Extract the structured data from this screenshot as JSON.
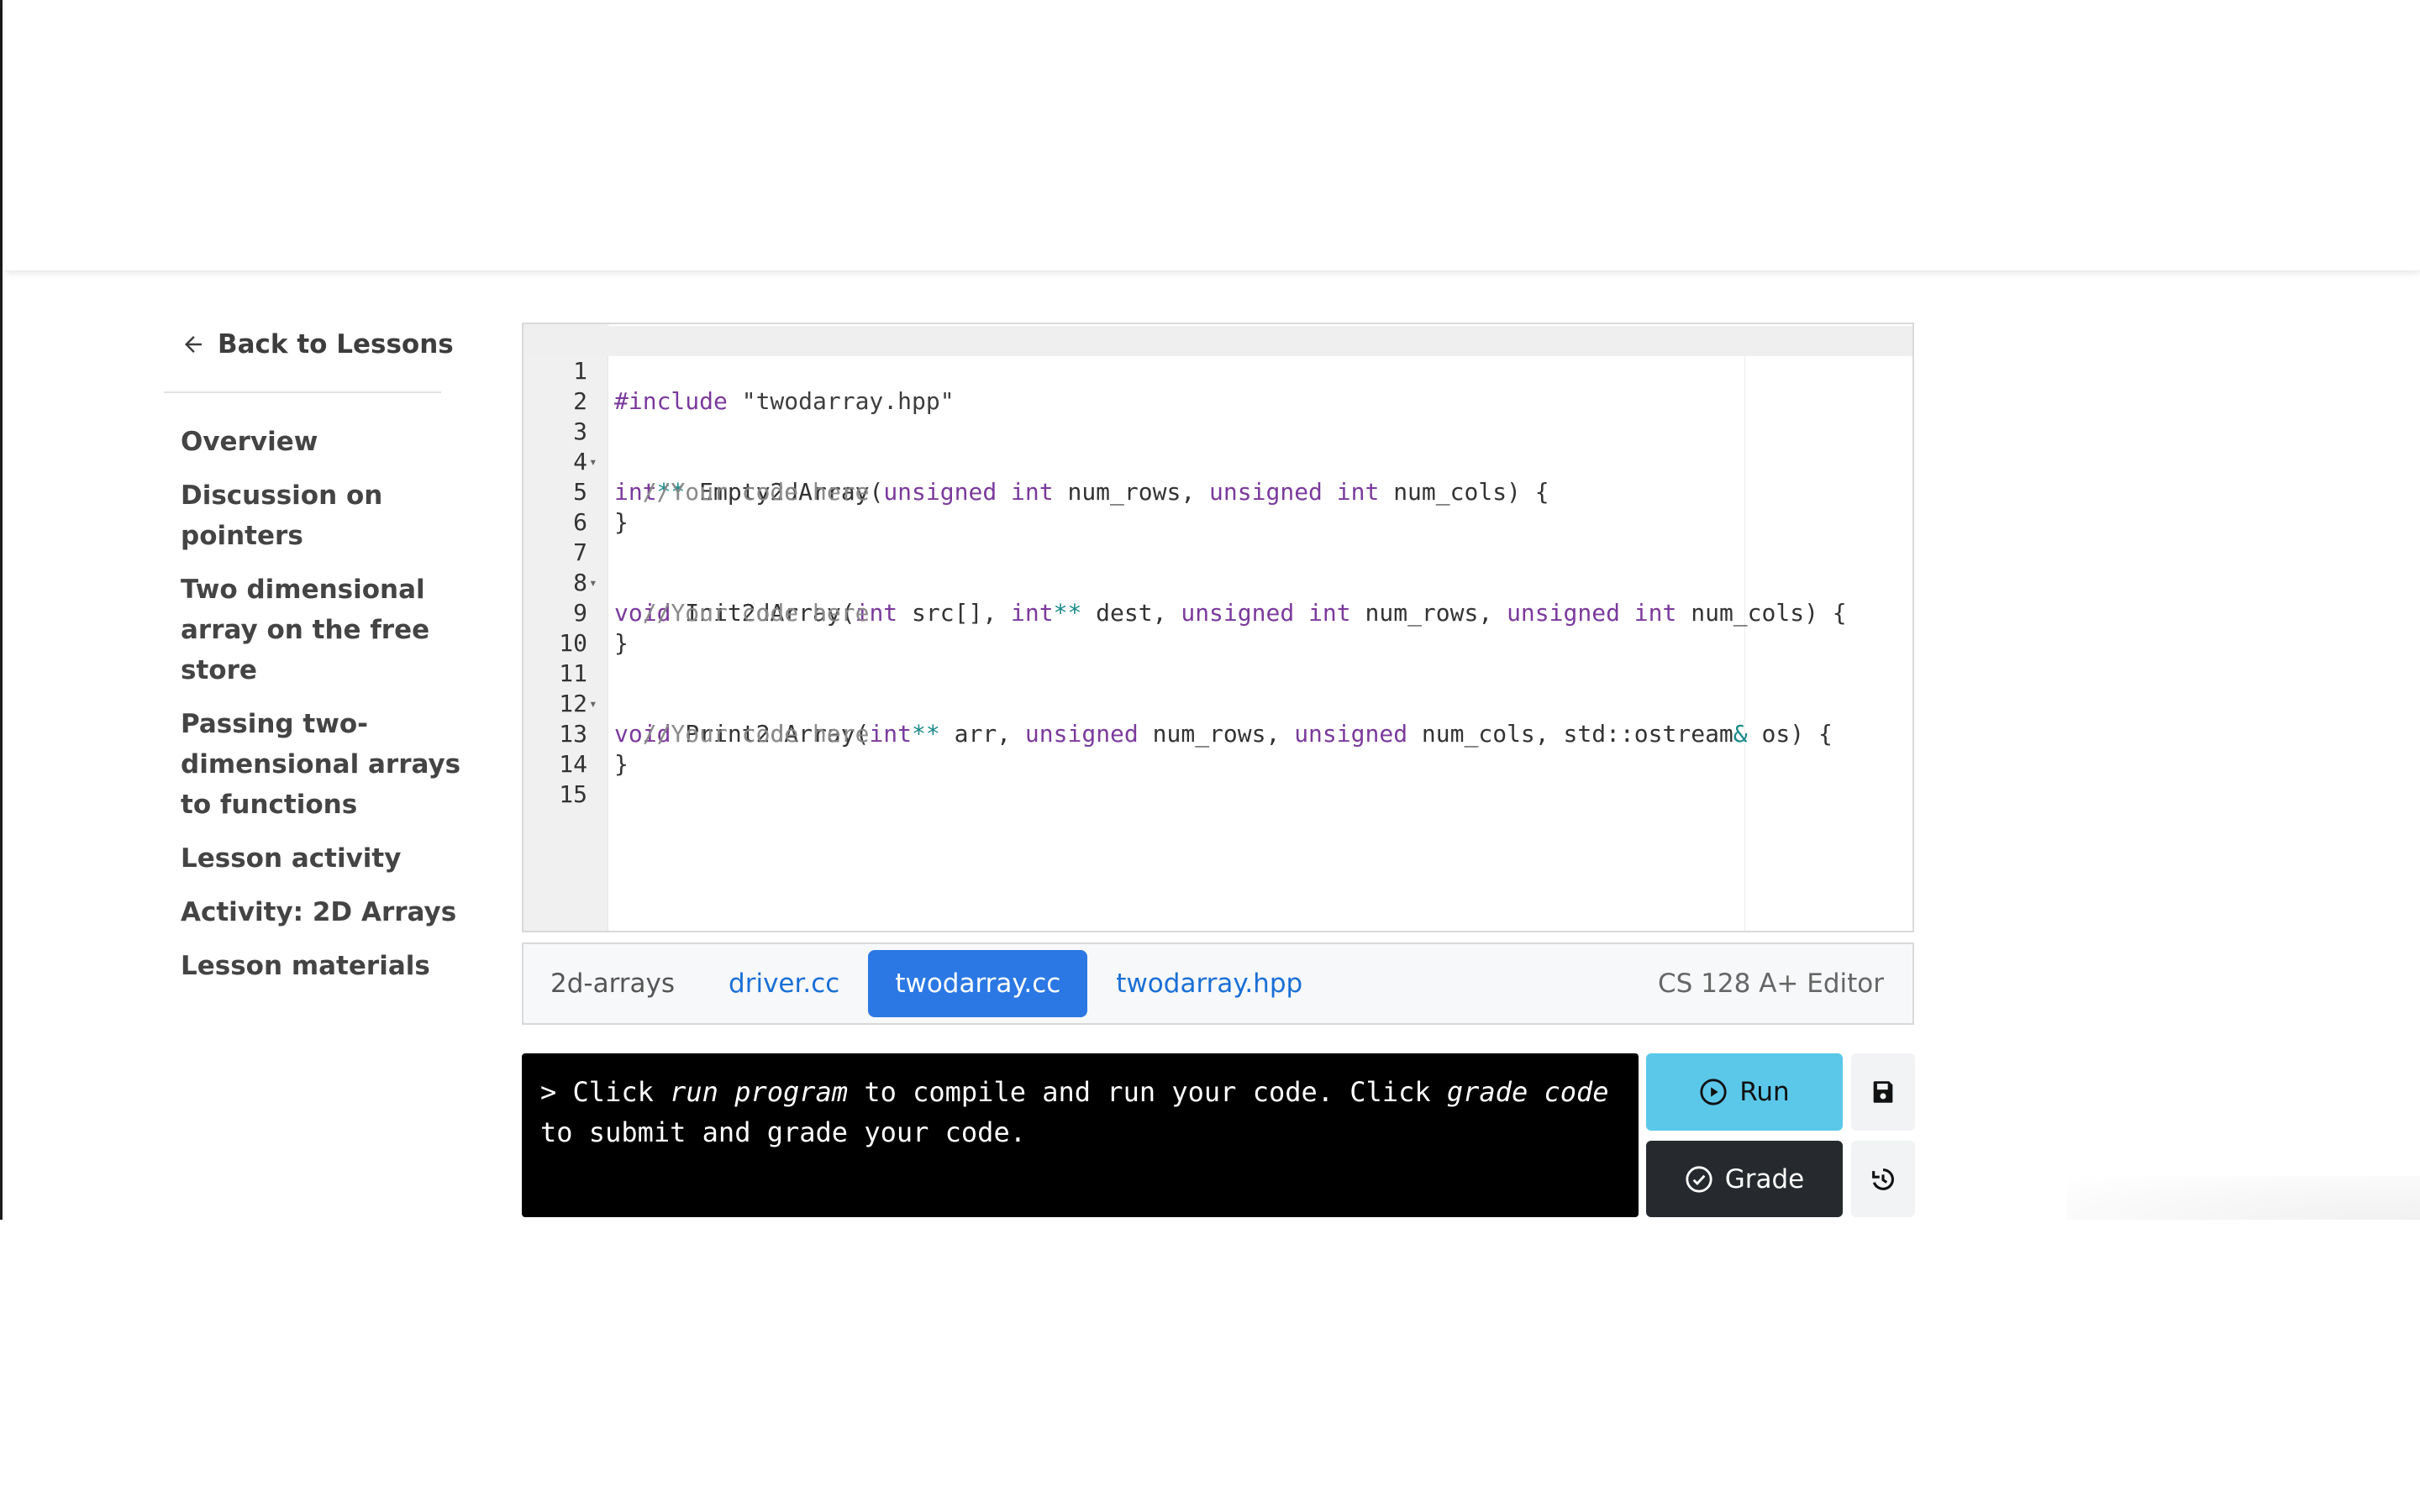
{
  "sidebar": {
    "back_label": "Back to Lessons",
    "items": [
      {
        "label": "Overview"
      },
      {
        "label": "Discussion on pointers"
      },
      {
        "label": "Two dimensional array on the free store"
      },
      {
        "label": "Passing two-dimensional arrays to functions"
      },
      {
        "label": "Lesson activity"
      },
      {
        "label": "Activity: 2D Arrays"
      },
      {
        "label": "Lesson materials"
      }
    ]
  },
  "editor": {
    "line_numbers": [
      "1",
      "2",
      "3",
      "4",
      "5",
      "6",
      "7",
      "8",
      "9",
      "10",
      "11",
      "12",
      "13",
      "14",
      "15"
    ],
    "code": {
      "l1_directive": "#include",
      "l1_file": " \"twodarray.hpp\"",
      "l3_type": "int",
      "l3_op": "**",
      "l3_name": " Empty2dArray(",
      "l3_kw1": "unsigned",
      "l3_kw2": "int",
      "l3_p1": " num_rows, ",
      "l3_kw3": "unsigned",
      "l3_kw4": "int",
      "l3_p2": " num_cols) {",
      "comment": "//Your code here",
      "brace": "}",
      "l7_void": "void",
      "l7_name": " Init2dArray(",
      "l7_int": "int",
      "l7_p1": " src[], ",
      "l7_int2": "int",
      "l7_op": "**",
      "l7_p2": " dest, ",
      "l7_kw1": "unsigned",
      "l7_kw2": "int",
      "l7_p3": " num_rows, ",
      "l7_kw3": "unsigned",
      "l7_kw4": "int",
      "l7_p4": " num_cols) {",
      "l11_void": "void",
      "l11_name": " Print2dArray(",
      "l11_int": "int",
      "l11_op": "**",
      "l11_p1": " arr, ",
      "l11_kw1": "unsigned",
      "l11_p2": " num_rows, ",
      "l11_kw2": "unsigned",
      "l11_p3": " num_cols, std::ostream",
      "l11_amp": "&",
      "l11_p4": " os) {"
    }
  },
  "tabs": {
    "project_label": "2d-arrays",
    "items": [
      {
        "label": "driver.cc"
      },
      {
        "label": "twodarray.cc"
      },
      {
        "label": "twodarray.hpp"
      }
    ],
    "active": "twodarray.cc",
    "editor_name": "CS 128 A+ Editor"
  },
  "console": {
    "prefix": "> Click ",
    "run_italic": "run program",
    "middle": " to compile and run your code. Click ",
    "grade_italic": "grade code",
    "suffix": " to submit and grade your code."
  },
  "buttons": {
    "run_label": "Run",
    "grade_label": "Grade"
  },
  "colors": {
    "run_button": "#5bc8ea",
    "grade_button": "#262a2e",
    "active_tab": "#2b78e4",
    "keyword": "#7b3a9c"
  }
}
